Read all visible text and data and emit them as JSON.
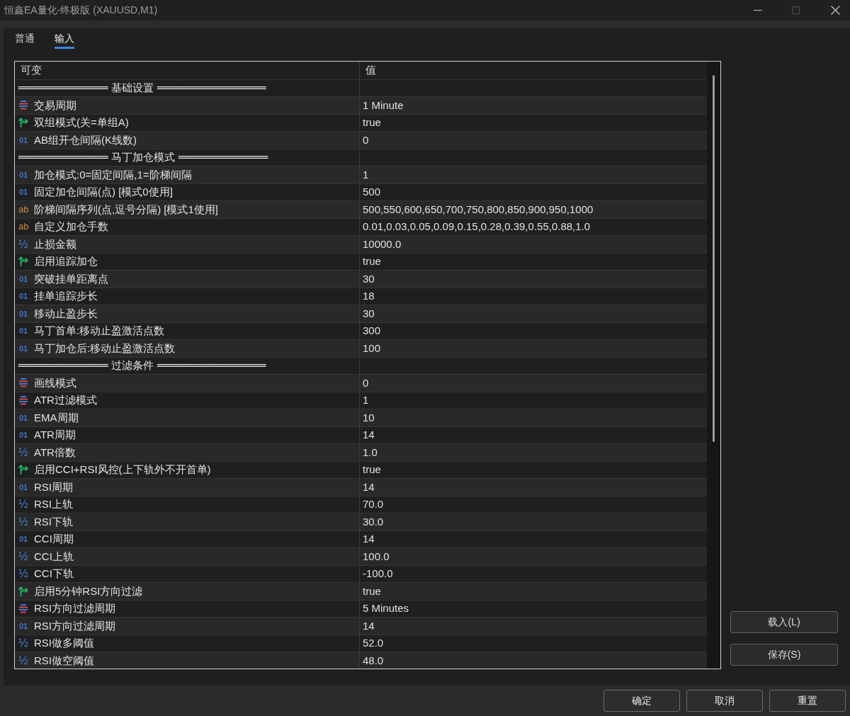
{
  "window": {
    "title": "恒鑫EA量化-终极版 (XAUUSD,M1)",
    "controls": [
      {
        "kind": "minimize",
        "disabled": false
      },
      {
        "kind": "maximize",
        "disabled": true
      },
      {
        "kind": "close",
        "disabled": false
      }
    ]
  },
  "tabs": [
    {
      "label": "普通",
      "selected": false
    },
    {
      "label": "输入",
      "selected": true
    }
  ],
  "table": {
    "columns": [
      "可变",
      "值"
    ],
    "rows": [
      {
        "kind": "separator",
        "name": "══════════════ 基础设置 ═════════════════"
      },
      {
        "kind": "enum",
        "name": "交易周期",
        "value": "1 Minute"
      },
      {
        "kind": "bool",
        "name": "双组模式(关=单组A)",
        "value": "true"
      },
      {
        "kind": "int",
        "glyph": "01",
        "name": "AB组开仓间隔(K线数)",
        "value": "0"
      },
      {
        "kind": "separator",
        "name": "══════════════ 马丁加仓模式 ══════════════"
      },
      {
        "kind": "int",
        "glyph": "01",
        "name": "加仓模式:0=固定间隔,1=阶梯间隔",
        "value": "1"
      },
      {
        "kind": "int",
        "glyph": "01",
        "name": "固定加仓间隔(点) [模式0使用]",
        "value": "500"
      },
      {
        "kind": "string",
        "glyph": "ab",
        "name": "阶梯间隔序列(点,逗号分隔) [模式1使用]",
        "value": "500,550,600,650,700,750,800,850,900,950,1000"
      },
      {
        "kind": "string",
        "glyph": "ab",
        "name": "自定义加仓手数",
        "value": "0.01,0.03,0.05,0.09,0.15,0.28,0.39,0.55,0.88,1.0"
      },
      {
        "kind": "double",
        "glyph": "½",
        "name": "止损金额",
        "value": "10000.0"
      },
      {
        "kind": "bool",
        "name": "启用追踪加仓",
        "value": "true"
      },
      {
        "kind": "int",
        "glyph": "01",
        "name": "突破挂单距离点",
        "value": "30"
      },
      {
        "kind": "int",
        "glyph": "01",
        "name": "挂单追踪步长",
        "value": "18"
      },
      {
        "kind": "int",
        "glyph": "01",
        "name": "移动止盈步长",
        "value": "30"
      },
      {
        "kind": "int",
        "glyph": "01",
        "name": "马丁首单:移动止盈激活点数",
        "value": "300"
      },
      {
        "kind": "int",
        "glyph": "01",
        "name": "马丁加仓后:移动止盈激活点数",
        "value": "100"
      },
      {
        "kind": "separator",
        "name": "══════════════ 过滤条件 ═════════════════"
      },
      {
        "kind": "enum",
        "name": "画线模式",
        "value": "0"
      },
      {
        "kind": "enum",
        "name": "ATR过滤模式",
        "value": "1"
      },
      {
        "kind": "int",
        "glyph": "01",
        "name": "EMA周期",
        "value": "10"
      },
      {
        "kind": "int",
        "glyph": "01",
        "name": "ATR周期",
        "value": "14"
      },
      {
        "kind": "double",
        "glyph": "½",
        "name": "ATR倍数",
        "value": "1.0"
      },
      {
        "kind": "bool",
        "name": "启用CCI+RSI风控(上下轨外不开首单)",
        "value": "true"
      },
      {
        "kind": "int",
        "glyph": "01",
        "name": "RSI周期",
        "value": "14"
      },
      {
        "kind": "double",
        "glyph": "½",
        "name": "RSI上轨",
        "value": "70.0"
      },
      {
        "kind": "double",
        "glyph": "½",
        "name": "RSI下轨",
        "value": "30.0"
      },
      {
        "kind": "int",
        "glyph": "01",
        "name": "CCI周期",
        "value": "14"
      },
      {
        "kind": "double",
        "glyph": "½",
        "name": "CCI上轨",
        "value": "100.0"
      },
      {
        "kind": "double",
        "glyph": "½",
        "name": "CCI下轨",
        "value": "-100.0"
      },
      {
        "kind": "bool",
        "name": "启用5分钟RSI方向过滤",
        "value": "true"
      },
      {
        "kind": "enum",
        "name": "RSI方向过滤周期",
        "value": "5 Minutes"
      },
      {
        "kind": "int",
        "glyph": "01",
        "name": "RSI方向过滤周期",
        "value": "14"
      },
      {
        "kind": "double",
        "glyph": "½",
        "name": "RSI做多阈值",
        "value": "52.0"
      },
      {
        "kind": "double",
        "glyph": "½",
        "name": "RSI做空阈值",
        "value": "48.0"
      }
    ]
  },
  "side_buttons": [
    "载入(L)",
    "保存(S)"
  ],
  "buttons": [
    "确定",
    "取消",
    "重置"
  ]
}
